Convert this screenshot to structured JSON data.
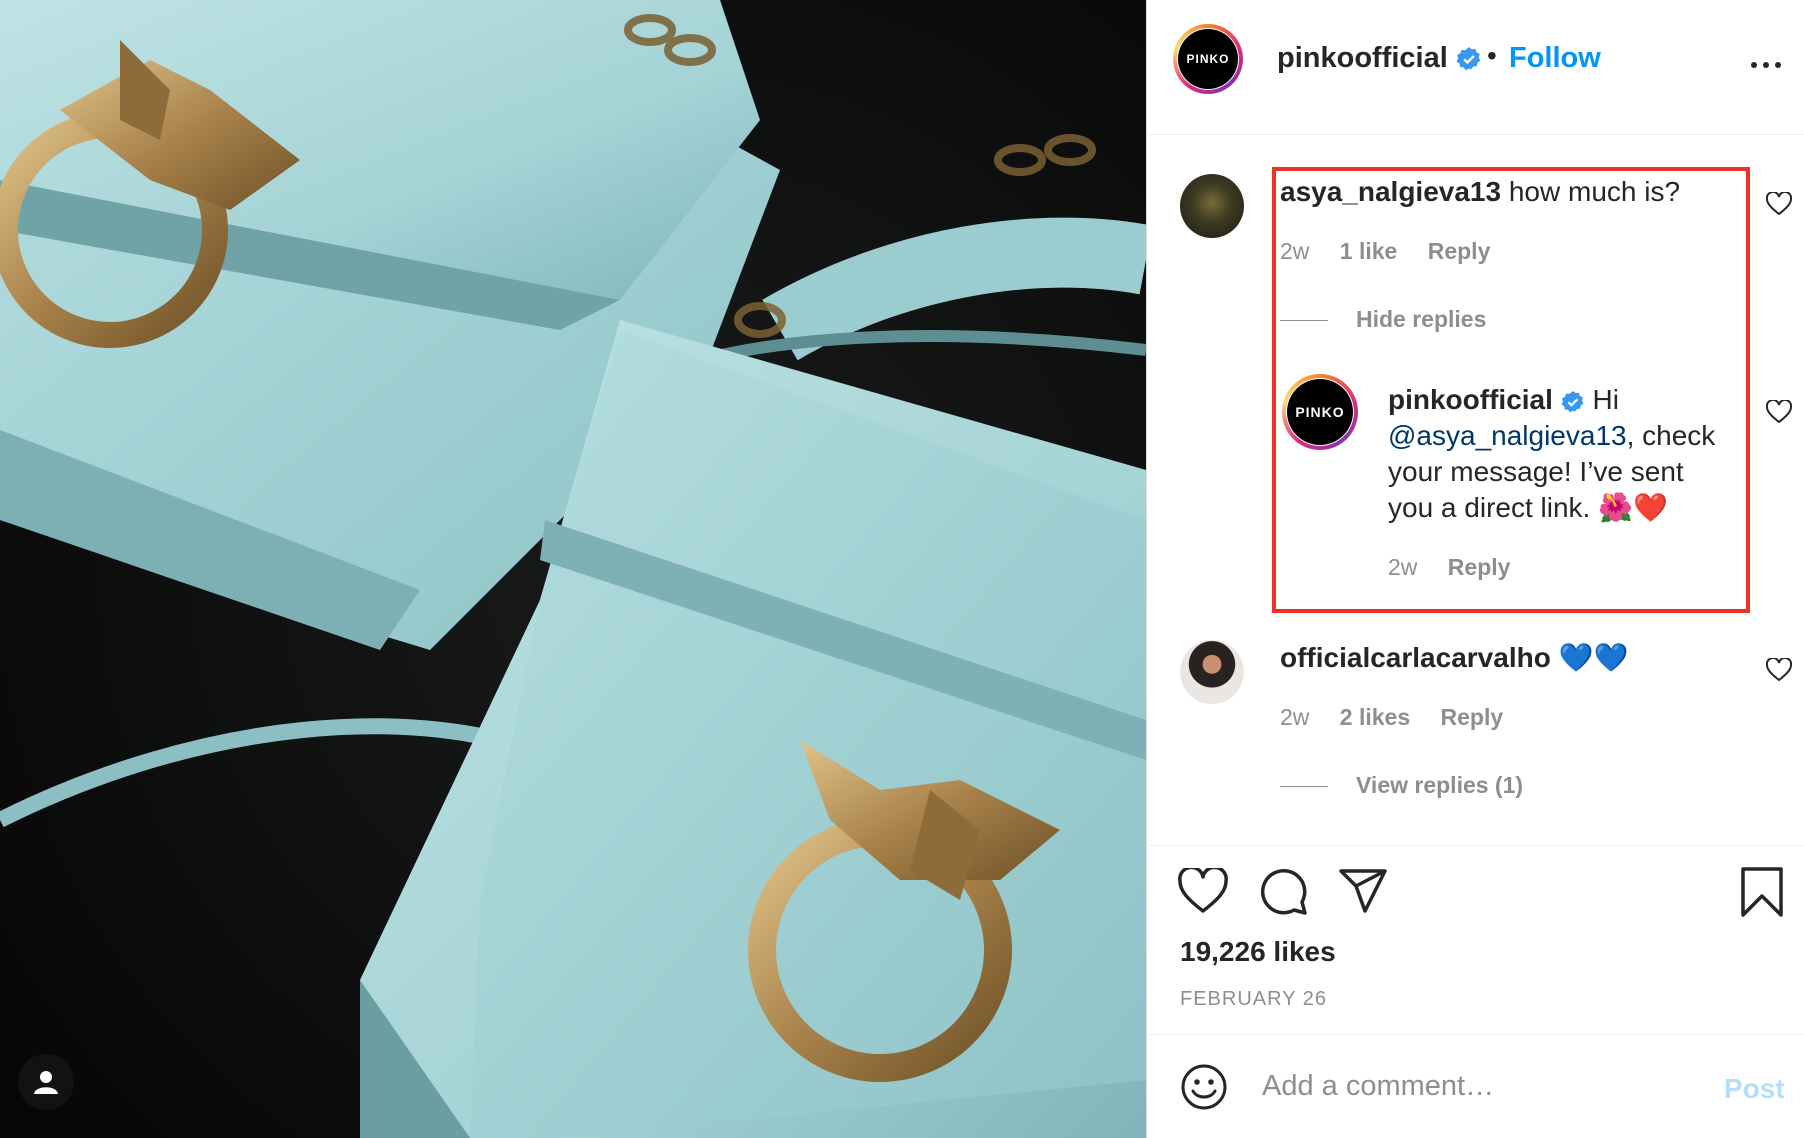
{
  "post": {
    "author": "pinkoofficial",
    "author_logo_text": "PINKO",
    "follow_label": "Follow",
    "separator": "•"
  },
  "comments": [
    {
      "username": "asya_nalgieva13",
      "text": "how much is?",
      "time": "2w",
      "likes": "1 like",
      "reply_label": "Reply",
      "replies_toggle": "Hide replies",
      "replies": [
        {
          "username": "pinkoofficial",
          "greeting": "Hi",
          "mention": "@asya_nalgieva13",
          "text": ", check your message! I’ve sent you a direct link. 🌺❤️",
          "time": "2w",
          "reply_label": "Reply"
        }
      ]
    },
    {
      "username": "officialcarlacarvalho",
      "text": "💙💙",
      "time": "2w",
      "likes": "2 likes",
      "reply_label": "Reply",
      "replies_toggle": "View replies (1)"
    }
  ],
  "stats": {
    "likes": "19,226 likes",
    "date": "FEBRUARY 26"
  },
  "composer": {
    "placeholder": "Add a comment…",
    "post_label": "Post"
  },
  "icons": {
    "photo_tag": "user-tag-icon",
    "verified": "verified-badge-icon",
    "more": "more-options-icon",
    "like": "heart-icon",
    "comment": "comment-bubble-icon",
    "share": "paper-plane-icon",
    "save": "bookmark-icon",
    "emoji": "emoji-smile-icon"
  },
  "colors": {
    "accent": "#0095f6",
    "highlight_box": "#ea3323",
    "secondary_text": "#8e8e8e",
    "mention": "#00376b",
    "photo_leather": "#a9d6d8"
  }
}
